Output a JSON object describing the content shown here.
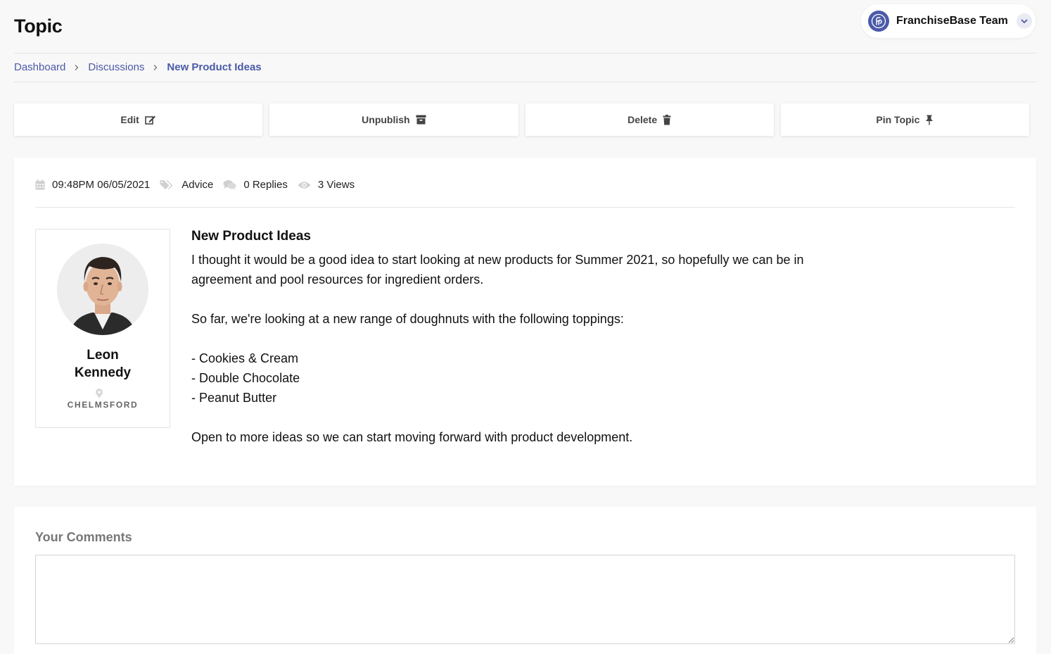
{
  "page": {
    "title": "Topic"
  },
  "team": {
    "name": "FranchiseBase Team"
  },
  "breadcrumb": [
    {
      "label": "Dashboard"
    },
    {
      "label": "Discussions"
    },
    {
      "label": "New Product Ideas"
    }
  ],
  "actions": {
    "edit": "Edit",
    "unpublish": "Unpublish",
    "delete": "Delete",
    "pin": "Pin Topic"
  },
  "meta": {
    "datetime": "09:48PM 06/05/2021",
    "category": "Advice",
    "replies": "0 Replies",
    "views": "3 Views"
  },
  "author": {
    "first_name": "Leon",
    "last_name": "Kennedy",
    "location": "CHELMSFORD"
  },
  "post": {
    "title": "New Product Ideas",
    "intro": "I thought it would be a good idea to start looking at new products for Summer 2021, so hopefully we can be in agreement and pool resources for ingredient orders.",
    "lead": "So far, we're looking at a new range of doughnuts with the following toppings:",
    "toppings": [
      "- Cookies & Cream",
      "- Double Chocolate",
      "- Peanut Butter"
    ],
    "closing": "Open to more ideas so we can start moving forward with product development."
  },
  "comments": {
    "label": "Your Comments",
    "value": ""
  },
  "icons": {
    "team_logo": "franchisebase-logo-icon",
    "chevron": "chevron-down-icon",
    "breadcrumb_sep": "chevron-right-icon",
    "edit": "edit-icon",
    "unpublish": "archive-icon",
    "delete": "trash-icon",
    "pin": "pin-icon",
    "datetime": "calendar-icon",
    "category": "tag-icon",
    "replies": "comments-icon",
    "views": "eye-icon",
    "location": "map-pin-icon"
  },
  "colors": {
    "accent": "#4b5aa8",
    "background": "#f8f8f8",
    "card": "#ffffff"
  }
}
